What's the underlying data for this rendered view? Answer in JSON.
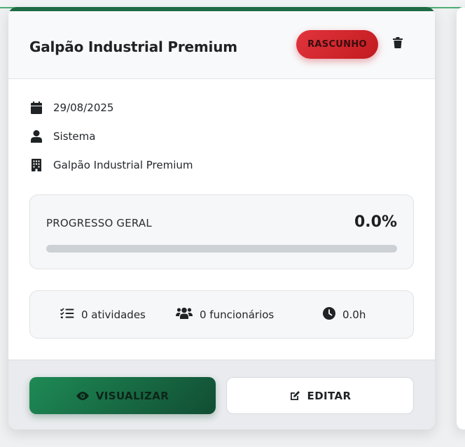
{
  "card": {
    "title": "Galpão Industrial Premium",
    "status": "RASCUNHO",
    "accent_color": "#1e6b44",
    "status_color": "#d62a31"
  },
  "meta": {
    "date": "29/08/2025",
    "author": "Sistema",
    "building": "Galpão Industrial Premium"
  },
  "progress": {
    "label": "PROGRESSO GERAL",
    "value_text": "0.0%",
    "fraction": 0.0
  },
  "stats": {
    "activities": "0 atividades",
    "employees": "0 funcionários",
    "hours": "0.0h"
  },
  "actions": {
    "view_label": "VISUALIZAR",
    "edit_label": "EDITAR"
  },
  "icons": {
    "date": "calendar-icon",
    "author": "user-icon",
    "building": "building-icon",
    "delete": "trash-icon",
    "activities": "checklist-icon",
    "employees": "users-icon",
    "hours": "clock-icon",
    "view": "eye-icon",
    "edit": "edit-icon"
  }
}
